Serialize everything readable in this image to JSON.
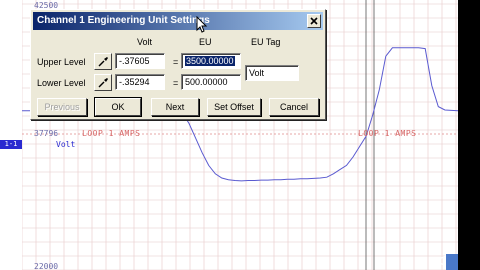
{
  "dialog": {
    "title": "Channel 1 Engineering Unit Settings",
    "headers": {
      "volt": "Volt",
      "eu": "EU",
      "eu_tag": "EU Tag"
    },
    "upper": {
      "label": "Upper Level",
      "volt": "-.37605",
      "eq": "=",
      "eu": "3500.00000"
    },
    "lower": {
      "label": "Lower Level",
      "volt": "-.35294",
      "eq": "=",
      "eu": "500.00000"
    },
    "eu_tag_value": "Volt",
    "buttons": {
      "previous": "Previous",
      "ok": "OK",
      "next": "Next",
      "set_offset": "Set Offset",
      "cancel": "Cancel"
    }
  },
  "chart": {
    "top_value": "42500",
    "mid_value": "37796",
    "bottom_value": "22000",
    "channel_tag": "1-1",
    "unit": "Volt",
    "loop_labels": [
      "LOOP 1 AMPS",
      "LOOP 1 AMPS"
    ]
  },
  "chart_data": {
    "type": "line",
    "title": "",
    "series": [
      {
        "values": [
          3.6,
          3.58,
          3.59,
          3.61,
          3.6,
          3.58,
          3.57,
          3.56,
          3.54,
          3.3,
          2.95,
          2.6,
          2.3,
          2.1,
          2.0,
          1.96,
          1.94,
          1.93,
          1.94,
          1.94,
          1.95,
          1.95,
          1.96,
          1.96,
          1.97,
          1.97,
          1.98,
          1.98,
          1.99,
          2.0,
          2.02,
          2.1,
          2.2,
          2.3,
          2.5,
          2.75,
          3.0,
          3.5,
          4.1,
          4.9,
          5.1,
          5.1,
          5.1,
          5.1,
          5.1,
          5.08,
          4.2,
          3.7,
          3.62,
          3.61,
          3.6
        ]
      }
    ],
    "x": [
      0,
      2,
      4,
      6,
      8,
      10,
      12,
      14,
      16,
      18,
      20,
      22,
      24,
      26,
      28,
      30,
      32,
      34,
      36,
      38,
      40,
      42,
      44,
      46,
      48,
      50,
      52,
      54,
      56,
      58,
      60,
      62,
      64,
      66,
      68,
      70,
      72,
      74,
      76,
      78,
      80,
      82,
      84,
      86,
      88,
      90,
      92,
      94,
      96,
      98,
      100
    ],
    "ylim": [
      0,
      6
    ],
    "grid": true
  },
  "colors": {
    "trace": "#5a5ad0",
    "grid": "#e6c8c8",
    "titlebar": "#0a246a",
    "accent": "#4a78c8"
  },
  "icons": {
    "close": "close-icon",
    "picker": "eyedropper-icon",
    "cursor": "mouse-pointer-icon"
  }
}
